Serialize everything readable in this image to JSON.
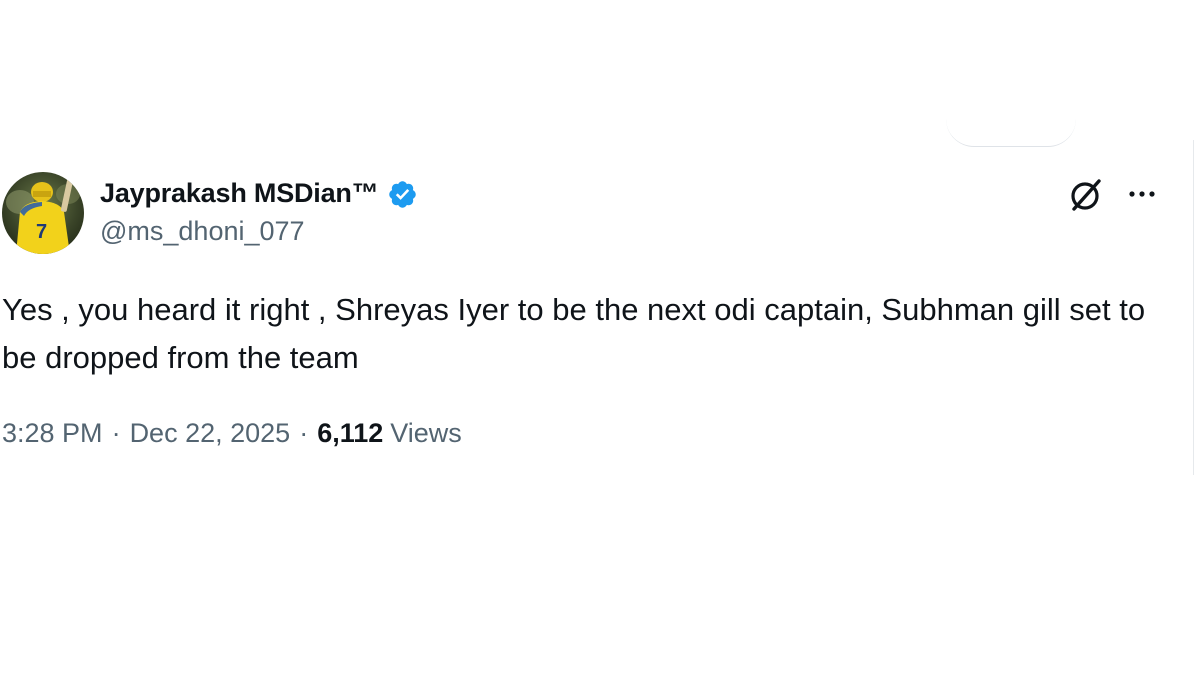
{
  "tweet": {
    "display_name": "Jayprakash MSDian™",
    "handle": "@ms_dhoni_077",
    "verified": true,
    "text": "Yes , you heard it right , Shreyas Iyer to be the next odi captain, Subhman gill set to be dropped from the team",
    "time": "3:28 PM",
    "separator": "·",
    "date": "Dec 22, 2025",
    "views_count": "6,112",
    "views_label": "Views"
  },
  "icons": {
    "verified": "verified-badge-icon",
    "grok": "grok-icon",
    "more": "more-horizontal-icon"
  },
  "colors": {
    "verified_blue": "#1d9bf0",
    "text_primary": "#0f1419",
    "text_secondary": "#536471"
  }
}
